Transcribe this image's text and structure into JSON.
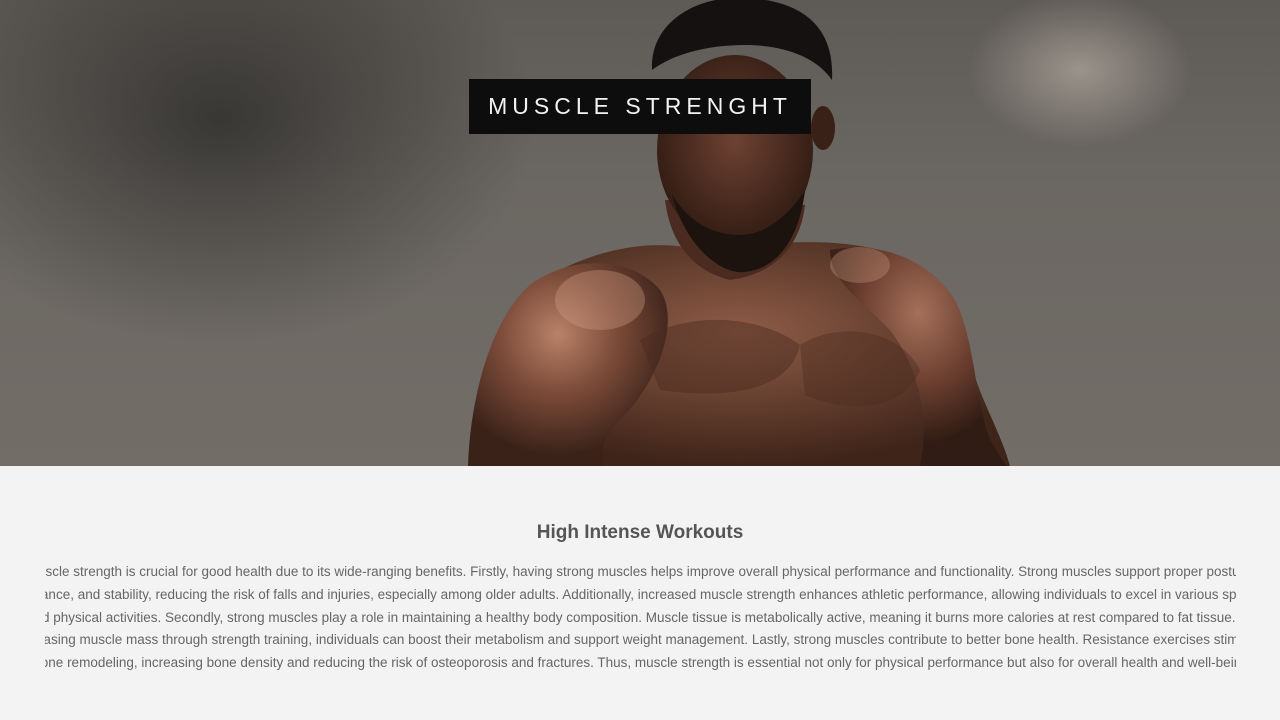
{
  "hero": {
    "title": "MUSCLE STRENGHT"
  },
  "section": {
    "heading": "High Intense Workouts",
    "body": "Muscle strength is crucial for good health due to its wide-ranging benefits. Firstly, having strong muscles helps improve overall physical performance and functionality. Strong muscles support proper posture, balance, and stability, reducing the risk of falls and injuries, especially among older adults. Additionally, increased muscle strength enhances athletic performance, allowing individuals to excel in various sports and physical activities. Secondly, strong muscles play a role in maintaining a healthy body composition. Muscle tissue is metabolically active, meaning it burns more calories at rest compared to fat tissue. By increasing muscle mass through strength training, individuals can boost their metabolism and support weight management. Lastly, strong muscles contribute to better bone health. Resistance exercises stimulate bone remodeling, increasing bone density and reducing the risk of osteoporosis and fractures. Thus, muscle strength is essential not only for physical performance but also for overall health and well-being"
  }
}
